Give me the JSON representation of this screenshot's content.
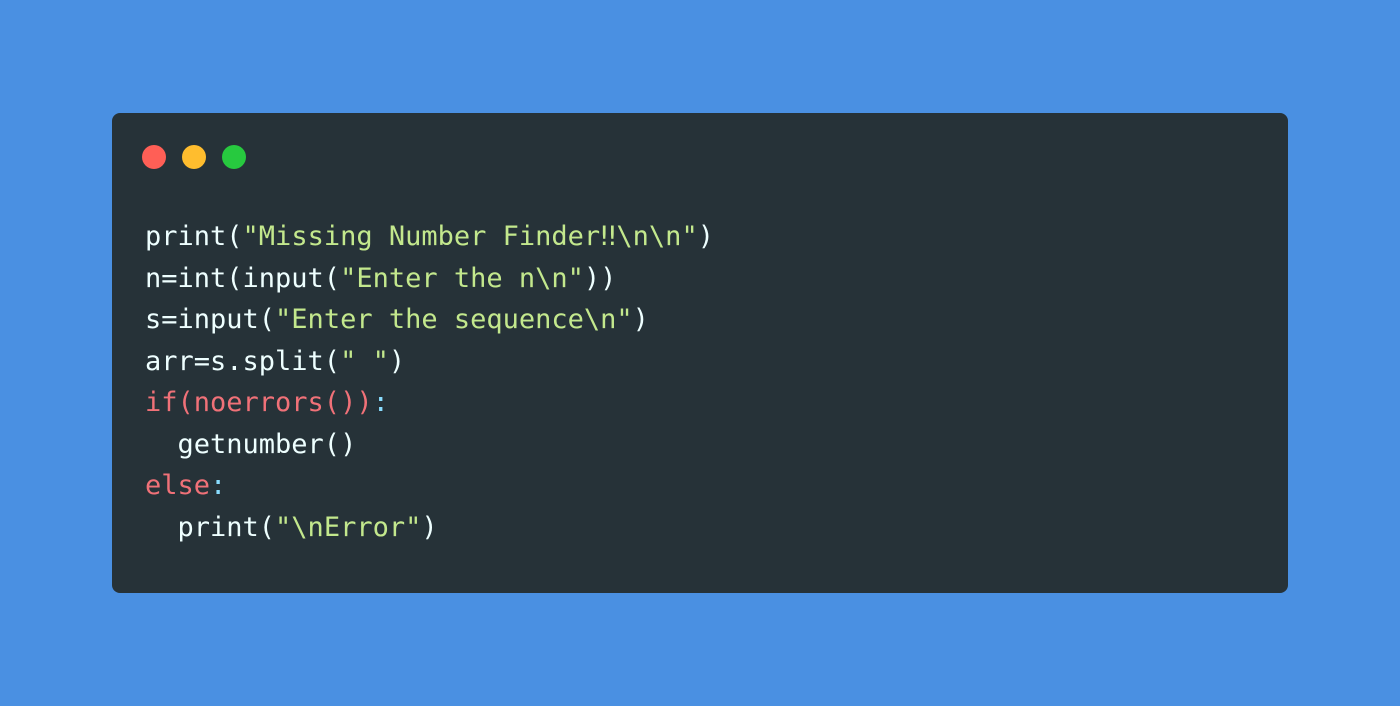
{
  "colors": {
    "background": "#4a90e2",
    "window": "#263238",
    "default_text": "#eeffff",
    "string": "#c3e88d",
    "keyword": "#f07178",
    "operator": "#89ddff"
  },
  "window_controls": [
    {
      "name": "close-dot",
      "color": "#ff5f56"
    },
    {
      "name": "minimize-dot",
      "color": "#ffbd2e"
    },
    {
      "name": "maximize-dot",
      "color": "#27c93f"
    }
  ],
  "code_lines": [
    [
      {
        "text": "print(",
        "type": "default"
      },
      {
        "text": "\"Missing Number Finder‼\\n\\n\"",
        "type": "string"
      },
      {
        "text": ")",
        "type": "default"
      }
    ],
    [
      {
        "text": "n=int(input(",
        "type": "default"
      },
      {
        "text": "\"Enter the n\\n\"",
        "type": "string"
      },
      {
        "text": "))",
        "type": "default"
      }
    ],
    [
      {
        "text": "s=input(",
        "type": "default"
      },
      {
        "text": "\"Enter the sequence\\n\"",
        "type": "string"
      },
      {
        "text": ")",
        "type": "default"
      }
    ],
    [
      {
        "text": "arr=s.split(",
        "type": "default"
      },
      {
        "text": "\" \"",
        "type": "string"
      },
      {
        "text": ")",
        "type": "default"
      }
    ],
    [
      {
        "text": "if(noerrors())",
        "type": "keyword"
      },
      {
        "text": ":",
        "type": "operator"
      }
    ],
    [
      {
        "text": "  getnumber()",
        "type": "default"
      }
    ],
    [
      {
        "text": "else",
        "type": "keyword"
      },
      {
        "text": ":",
        "type": "operator"
      }
    ],
    [
      {
        "text": "  print(",
        "type": "default"
      },
      {
        "text": "\"\\nError\"",
        "type": "string"
      },
      {
        "text": ")",
        "type": "default"
      }
    ]
  ]
}
